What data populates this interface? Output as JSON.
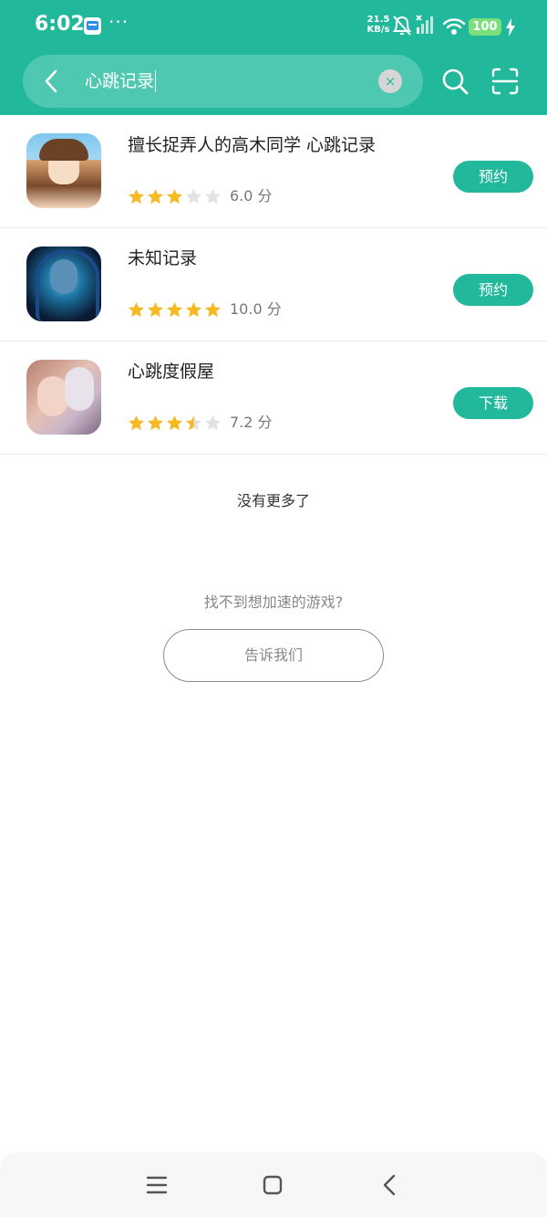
{
  "status_bar": {
    "time": "6:02",
    "more_indicator": "···",
    "net_speed_value": "21.5",
    "net_speed_unit": "KB/s",
    "battery_level": "100",
    "icons": [
      "notification-app-icon",
      "mute-bell-icon",
      "signal-icon",
      "wifi-icon",
      "battery-icon",
      "charging-icon"
    ]
  },
  "search": {
    "query": "心跳记录",
    "clear_label": "×"
  },
  "results": [
    {
      "title": "擅长捉弄人的高木同学 心跳记录",
      "rating": 3,
      "score": "6.0 分",
      "action": "预约",
      "icon": "takagi"
    },
    {
      "title": "未知记录",
      "rating": 5,
      "score": "10.0 分",
      "action": "预约",
      "icon": "weizhi"
    },
    {
      "title": "心跳度假屋",
      "rating": 3.5,
      "score": "7.2 分",
      "action": "下载",
      "icon": "dujia"
    }
  ],
  "footer": {
    "no_more": "没有更多了",
    "cant_find": "找不到想加速的游戏?",
    "tell_us": "告诉我们"
  },
  "colors": {
    "brand": "#21b89c",
    "search_bg": "#4fc8b1",
    "star_on": "#f5b922",
    "star_off": "#e2e2e2"
  }
}
